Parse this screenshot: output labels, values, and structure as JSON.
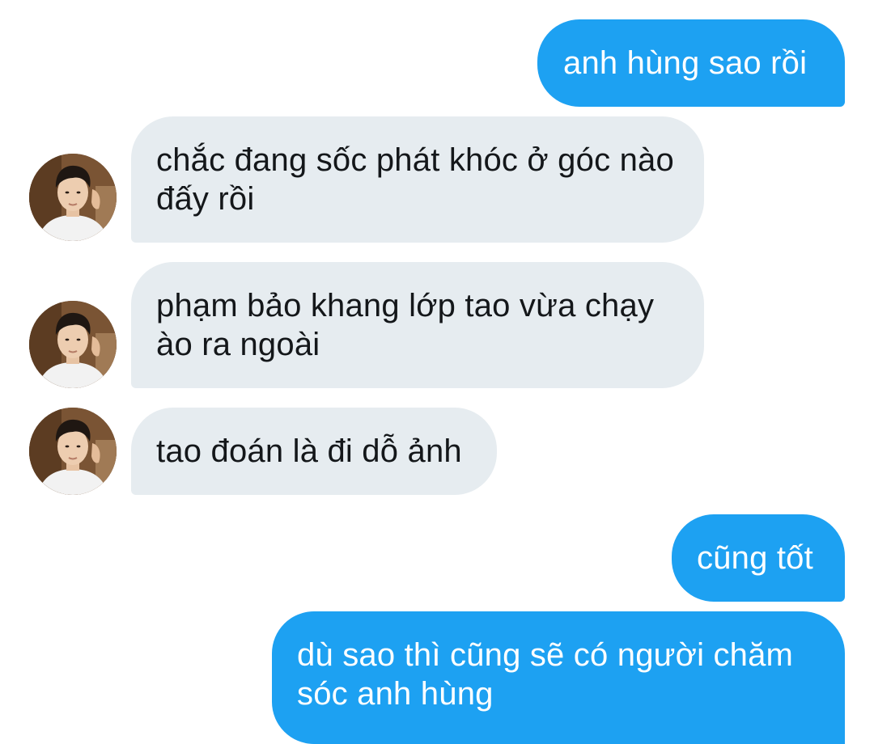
{
  "conversation": {
    "messages": [
      {
        "direction": "outgoing",
        "text": "anh hùng sao rồi"
      },
      {
        "direction": "incoming",
        "text": "chắc đang sốc phát khóc ở góc nào đấy rồi"
      },
      {
        "direction": "incoming",
        "text": "phạm bảo khang lớp tao vừa chạy ào ra ngoài"
      },
      {
        "direction": "incoming",
        "text": "tao đoán là đi dỗ ảnh"
      },
      {
        "direction": "outgoing",
        "text": "cũng tốt"
      },
      {
        "direction": "outgoing",
        "text": "dù sao thì cũng sẽ có người chăm sóc anh hùng"
      }
    ]
  },
  "colors": {
    "outgoing_bubble": "#1da1f2",
    "incoming_bubble": "#e6ecf0",
    "outgoing_text": "#ffffff",
    "incoming_text": "#14171a"
  },
  "icons": {
    "avatar": "user-avatar-photo"
  }
}
